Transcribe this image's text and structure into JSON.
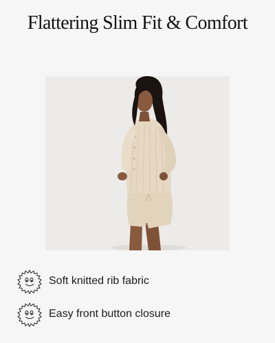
{
  "header": {
    "title": "Flattering Slim Fit & Comfort"
  },
  "photo": {
    "icon": "model-photo",
    "background_color": "#ecebe9",
    "garment_color": "#e6d8c3",
    "skin_color": "#8a5a3f",
    "hair_color": "#1b1310"
  },
  "features": [
    {
      "icon": "smiley-sun-icon",
      "label": "Soft knitted rib fabric"
    },
    {
      "icon": "smiley-sun-icon",
      "label": "Easy front button closure"
    }
  ]
}
